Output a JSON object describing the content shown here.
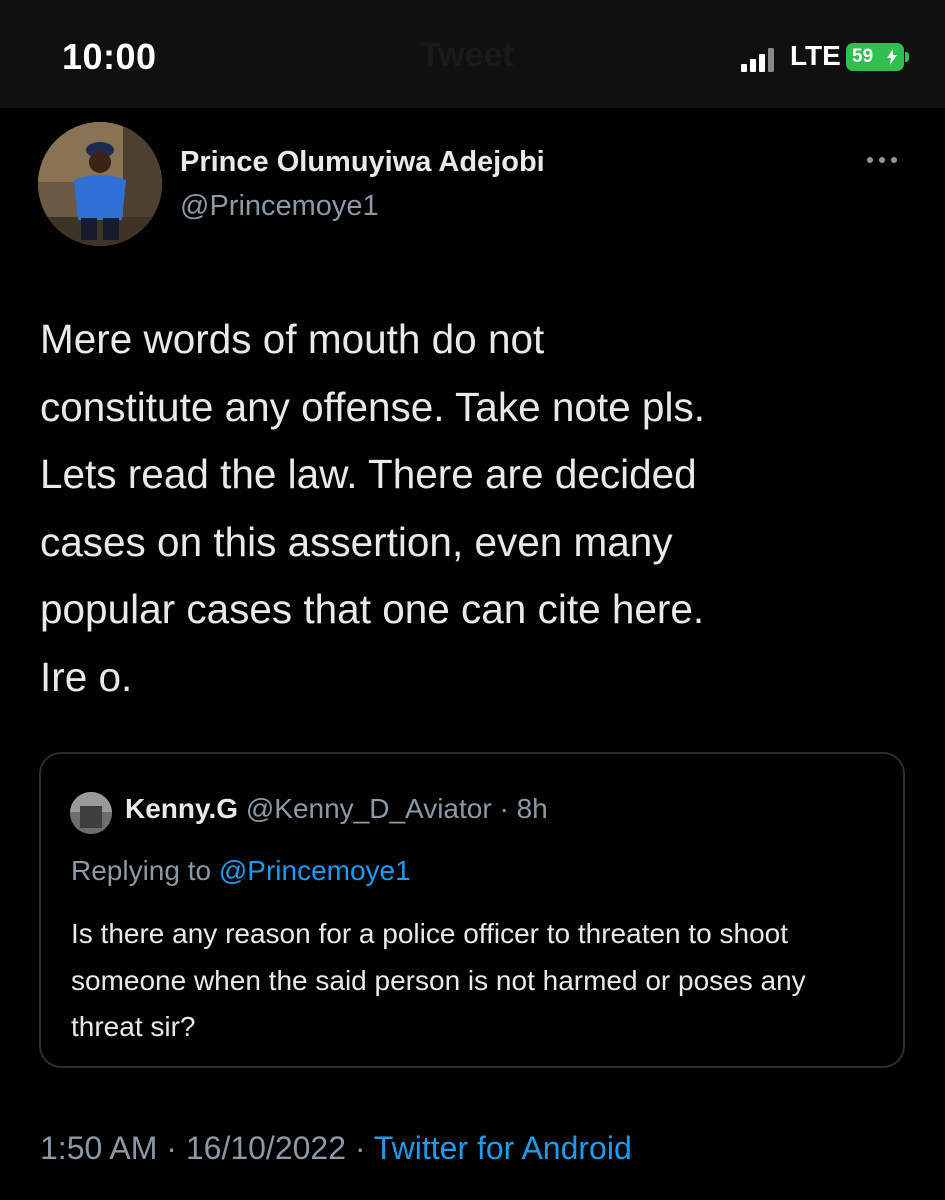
{
  "status_bar": {
    "time": "10:00",
    "background_title": "Tweet",
    "network": "LTE",
    "battery": "59",
    "signal_icon": "signal-bars-icon",
    "charging_icon": "bolt-icon"
  },
  "tweet": {
    "author_name": "Prince Olumuyiwa Adejobi",
    "author_handle": "@Princemoye1",
    "text": "Mere words of mouth do not\nconstitute any offense. Take note pls.\nLets read the law. There are decided\ncases on this assertion, even many\npopular cases that one can cite here.\nIre o.",
    "more_icon": "more-horizontal-icon",
    "time": "1:50 AM",
    "date": "16/10/2022",
    "source": "Twitter for Android",
    "separator": "·"
  },
  "quote": {
    "author_name": "Kenny.G",
    "author_handle": "@Kenny_D_Aviator",
    "separator": "·",
    "time_ago": "8h",
    "replying_label": "Replying to ",
    "replying_to": "@Princemoye1",
    "text": "Is there any reason for a police officer to threaten to shoot someone when the said person is not harmed or poses any threat sir?"
  },
  "colors": {
    "background": "#000000",
    "text_primary": "#e7e9ea",
    "text_secondary": "#8b98a5",
    "link": "#1d9bf0",
    "battery": "#2fc050",
    "border": "#2a2d31"
  }
}
